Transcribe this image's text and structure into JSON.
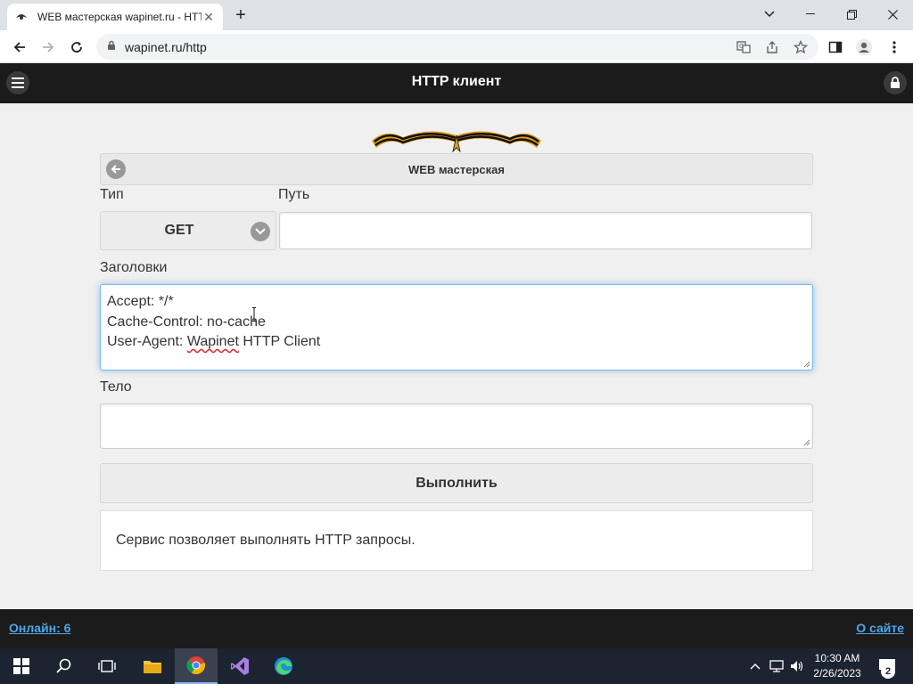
{
  "browser": {
    "tab_title": "WEB мастерская wapinet.ru - HTTP клиент",
    "new_tab_icon": "plus-icon",
    "url": "wapinet.ru/http"
  },
  "header": {
    "title": "HTTP клиент",
    "menu_icon": "hamburger-menu-icon",
    "lock_icon": "lock-icon"
  },
  "breadcrumb": {
    "label": "WEB мастерская",
    "back_icon": "arrow-left-circle-icon"
  },
  "form": {
    "type_label": "Тип",
    "path_label": "Путь",
    "method_value": "GET",
    "path_value": "",
    "headers_label": "Заголовки",
    "headers_lines": [
      "Accept: */*",
      "Cache-Control: no-cache",
      "User-Agent: "
    ],
    "headers_spellcheck_word": "Wapinet",
    "headers_tail": " HTTP Client",
    "body_label": "Тело",
    "body_value": "",
    "submit_label": "Выполнить"
  },
  "info": {
    "text": "Сервис позволяет выполнять HTTP запросы."
  },
  "footer": {
    "online_label": "Онлайн: 6",
    "about_label": "О сайте"
  },
  "taskbar": {
    "time": "10:30 AM",
    "date": "2/26/2023",
    "notifications_count": "2"
  },
  "colors": {
    "header_bg": "#1b1b1b",
    "link": "#4ea6e8",
    "focus": "#7ab8e8"
  }
}
